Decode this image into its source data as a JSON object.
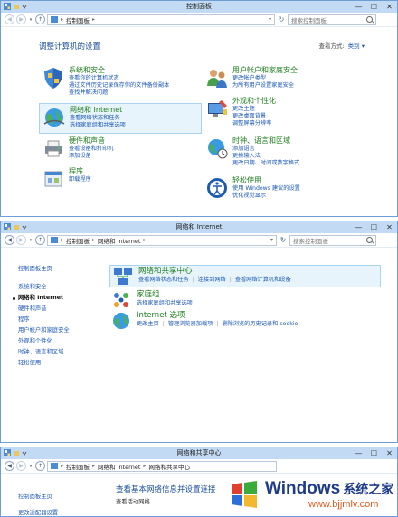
{
  "window1": {
    "title": "控制面板",
    "breadcrumb": [
      "控制面板"
    ],
    "search_placeholder": "搜索控制面板",
    "heading": "调整计算机的设置",
    "view_by_label": "查看方式:",
    "view_by_value": "类别",
    "categories": [
      {
        "title": "系统和安全",
        "links": [
          "查看你的计算机状态",
          "通过文件历史记录保存你的文件备份副本",
          "查找并解决问题"
        ]
      },
      {
        "title": "网络和 Internet",
        "links": [
          "查看网络状态和任务",
          "选择家庭组和共享选项"
        ]
      },
      {
        "title": "硬件和声音",
        "links": [
          "查看设备和打印机",
          "添加设备"
        ]
      },
      {
        "title": "程序",
        "links": [
          "卸载程序"
        ]
      },
      {
        "title": "用户帐户和家庭安全",
        "links": [
          "更改帐户类型",
          "为所有用户设置家庭安全"
        ]
      },
      {
        "title": "外观和个性化",
        "links": [
          "更改主题",
          "更改桌面背景",
          "调整屏幕分辨率"
        ]
      },
      {
        "title": "时钟、语言和区域",
        "links": [
          "添加语言",
          "更换输入法",
          "更改日期、时间或数字格式"
        ]
      },
      {
        "title": "轻松使用",
        "links": [
          "使用 Windows 建议的设置",
          "优化视觉显示"
        ]
      }
    ]
  },
  "window2": {
    "title": "网络和 Internet",
    "breadcrumb": [
      "控制面板",
      "网络和 Internet"
    ],
    "search_placeholder": "搜索控制面板",
    "sidebar": [
      "控制面板主页",
      "系统和安全",
      "网络和 Internet",
      "硬件和声音",
      "程序",
      "用户帐户和家庭安全",
      "外观和个性化",
      "时钟、语言和区域",
      "轻松使用"
    ],
    "sections": [
      {
        "title": "网络和共享中心",
        "links": [
          "查看网络状态和任务",
          "连接到网络",
          "查看网络计算机和设备"
        ]
      },
      {
        "title": "家庭组",
        "links": [
          "选择家庭组和共享选项"
        ]
      },
      {
        "title": "Internet 选项",
        "links": [
          "更改主页",
          "管理浏览器加载项",
          "删除浏览的历史记录和 cookie"
        ]
      }
    ]
  },
  "window3": {
    "title": "网络和共享中心",
    "breadcrumb": [
      "控制面板",
      "网络和 Internet",
      "网络和共享中心"
    ],
    "sidebar": [
      "控制面板主页",
      "更改适配器设置"
    ],
    "heading": "查看基本网络信息并设置连接",
    "subheading": "查看活动网络"
  },
  "window_controls": {
    "minimize": "—",
    "maximize": "☐",
    "close": "✕"
  },
  "watermark": {
    "brand": "Windows",
    "brand_cn": "系统之家",
    "url": "www.bjjmlv.com"
  },
  "colors": {
    "link": "#1b57b6",
    "category_title": "#1e7d1e",
    "title_bar": "#c2daf3",
    "highlight": "#e8f4fb"
  }
}
